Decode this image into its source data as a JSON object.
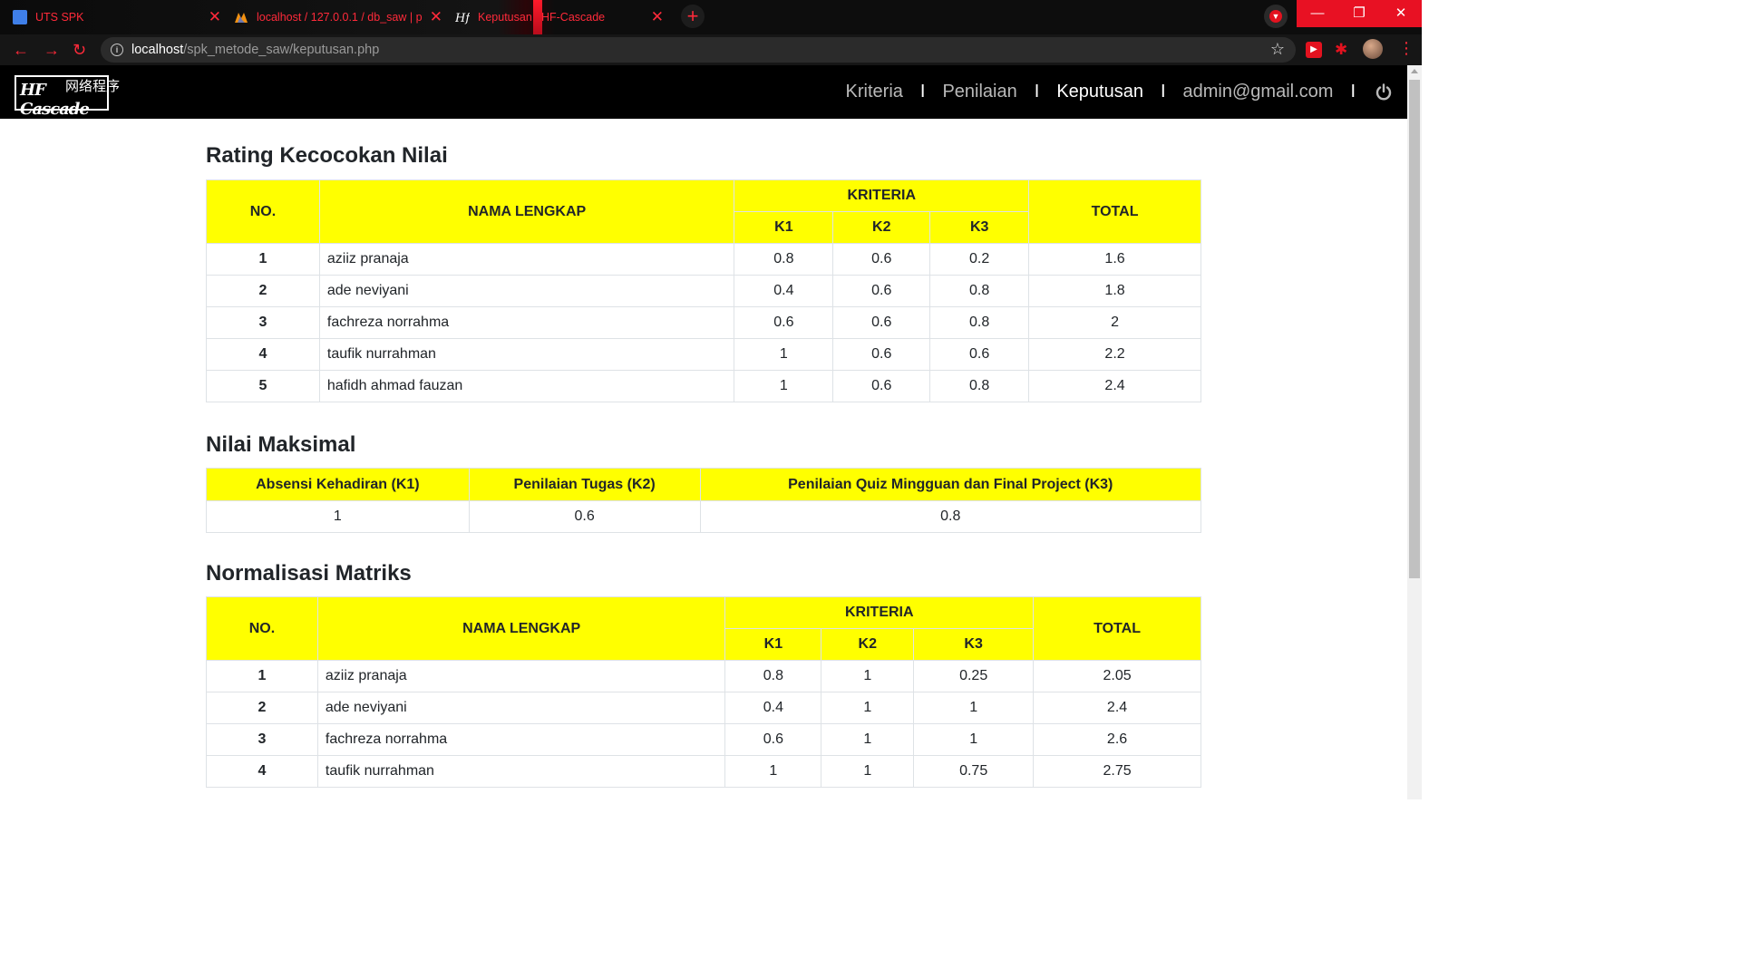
{
  "browser": {
    "tabs": [
      {
        "title": "UTS SPK",
        "icon": "people-icon",
        "close": "✕"
      },
      {
        "title": "localhost / 127.0.0.1 / db_saw | p",
        "icon": "phpmyadmin-icon",
        "close": "✕"
      },
      {
        "title": "Keputusan | HF-Cascade",
        "icon": "hf-logo-icon",
        "close": "✕"
      }
    ],
    "new_tab": "+",
    "url_host": "localhost",
    "url_path": "/spk_metode_saw/keputusan.php",
    "accent_color": "#ff2a3a"
  },
  "navbar": {
    "logo_cn": "网络程序",
    "logo_script": "HF Cascade",
    "links": [
      {
        "label": "Kriteria",
        "active": false
      },
      {
        "label": "Penilaian",
        "active": false
      },
      {
        "label": "Keputusan",
        "active": true
      },
      {
        "label": "admin@gmail.com",
        "active": false
      }
    ],
    "separator": "I"
  },
  "rating": {
    "title": "Rating Kecocokan Nilai",
    "headers": {
      "no": "NO.",
      "name": "NAMA LENGKAP",
      "kriteria": "KRITERIA",
      "k1": "K1",
      "k2": "K2",
      "k3": "K3",
      "total": "TOTAL"
    },
    "rows": [
      {
        "no": "1",
        "name": "aziiz pranaja",
        "k1": "0.8",
        "k2": "0.6",
        "k3": "0.2",
        "total": "1.6"
      },
      {
        "no": "2",
        "name": "ade neviyani",
        "k1": "0.4",
        "k2": "0.6",
        "k3": "0.8",
        "total": "1.8"
      },
      {
        "no": "3",
        "name": "fachreza norrahma",
        "k1": "0.6",
        "k2": "0.6",
        "k3": "0.8",
        "total": "2"
      },
      {
        "no": "4",
        "name": "taufik nurrahman",
        "k1": "1",
        "k2": "0.6",
        "k3": "0.6",
        "total": "2.2"
      },
      {
        "no": "5",
        "name": "hafidh ahmad fauzan",
        "k1": "1",
        "k2": "0.6",
        "k3": "0.8",
        "total": "2.4"
      }
    ]
  },
  "maksimal": {
    "title": "Nilai Maksimal",
    "headers": [
      "Absensi Kehadiran (K1)",
      "Penilaian Tugas (K2)",
      "Penilaian Quiz Mingguan dan Final Project (K3)"
    ],
    "values": [
      "1",
      "0.6",
      "0.8"
    ]
  },
  "normalisasi": {
    "title": "Normalisasi Matriks",
    "headers": {
      "no": "NO.",
      "name": "NAMA LENGKAP",
      "kriteria": "KRITERIA",
      "k1": "K1",
      "k2": "K2",
      "k3": "K3",
      "total": "TOTAL"
    },
    "rows": [
      {
        "no": "1",
        "name": "aziiz pranaja",
        "k1": "0.8",
        "k2": "1",
        "k3": "0.25",
        "total": "2.05"
      },
      {
        "no": "2",
        "name": "ade neviyani",
        "k1": "0.4",
        "k2": "1",
        "k3": "1",
        "total": "2.4"
      },
      {
        "no": "3",
        "name": "fachreza norrahma",
        "k1": "0.6",
        "k2": "1",
        "k3": "1",
        "total": "2.6"
      },
      {
        "no": "4",
        "name": "taufik nurrahman",
        "k1": "1",
        "k2": "1",
        "k3": "0.75",
        "total": "2.75"
      }
    ]
  },
  "colors": {
    "header_bg": "#ffff00",
    "navbar_bg": "#000000"
  }
}
